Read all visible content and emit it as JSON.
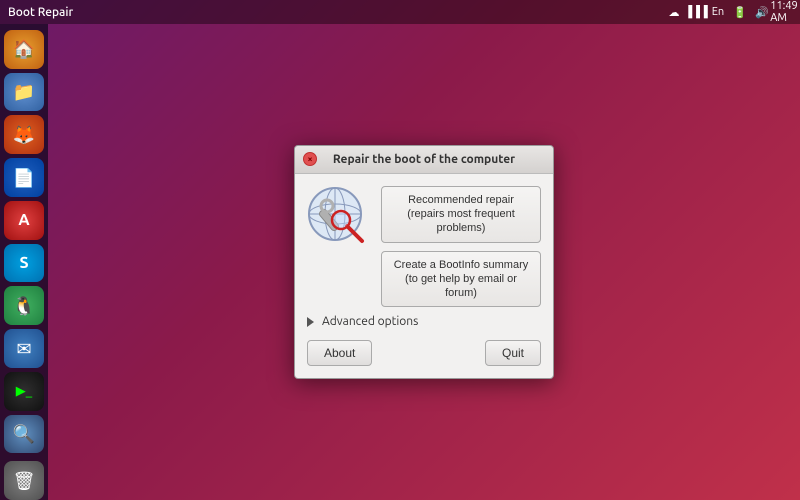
{
  "topbar": {
    "title": "Boot Repair",
    "time": "11:49 AM",
    "icons": [
      "dropbox",
      "signal",
      "en",
      "battery",
      "volume"
    ]
  },
  "sidebar": {
    "items": [
      {
        "id": "home",
        "label": "🏠",
        "class": "icon-home"
      },
      {
        "id": "files",
        "label": "📁",
        "class": "icon-files"
      },
      {
        "id": "firefox",
        "label": "🦊",
        "class": "icon-firefox"
      },
      {
        "id": "writer",
        "label": "📝",
        "class": "icon-writer"
      },
      {
        "id": "appstore",
        "label": "A",
        "class": "icon-appstore"
      },
      {
        "id": "skype",
        "label": "S",
        "class": "icon-skype"
      },
      {
        "id": "pia",
        "label": "🐧",
        "class": "icon-pia"
      },
      {
        "id": "email",
        "label": "✉",
        "class": "icon-email"
      },
      {
        "id": "terminal",
        "label": "⬛",
        "class": "icon-terminal"
      },
      {
        "id": "search",
        "label": "🔍",
        "class": "icon-search"
      },
      {
        "id": "trash",
        "label": "🗑",
        "class": "icon-trash"
      }
    ]
  },
  "dialog": {
    "title": "Repair the boot of the computer",
    "close_label": "×",
    "recommended_repair_line1": "Recommended repair",
    "recommended_repair_line2": "(repairs most frequent problems)",
    "bootinfo_line1": "Create a BootInfo summary",
    "bootinfo_line2": "(to get help by email or forum)",
    "advanced_options_label": "Advanced options",
    "about_label": "About",
    "quit_label": "Quit"
  }
}
